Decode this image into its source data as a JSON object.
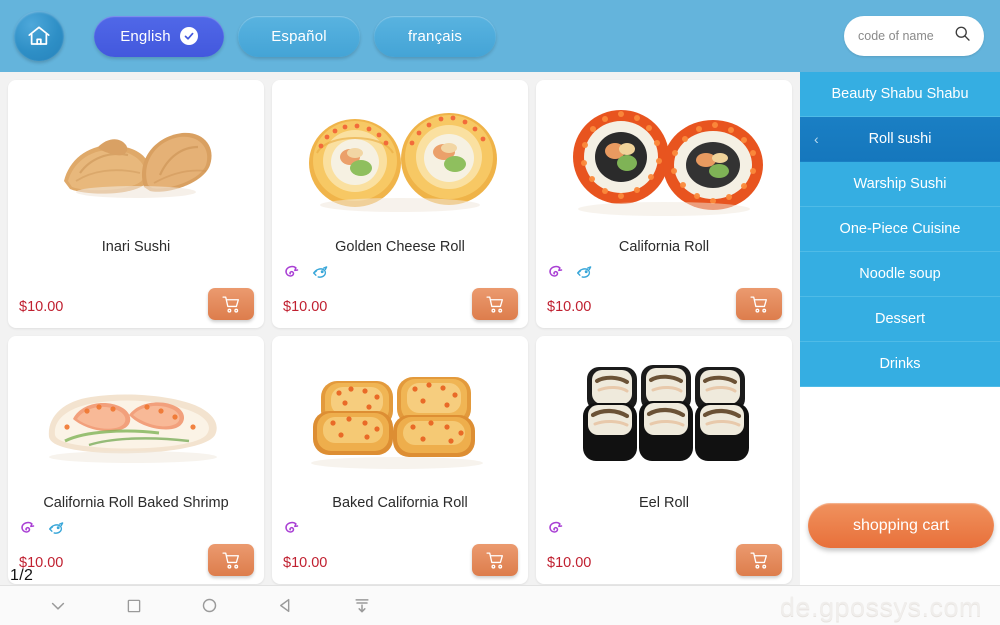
{
  "header": {
    "home_icon": "home-icon",
    "search": {
      "placeholder": "code of name",
      "value": "",
      "icon": "search-icon"
    },
    "languages": [
      {
        "label": "English",
        "active": true,
        "check_icon": "check-circle-icon"
      },
      {
        "label": "Español",
        "active": false
      },
      {
        "label": "français",
        "active": false
      }
    ]
  },
  "products": [
    {
      "name": "Inari Sushi",
      "price": "$10.00",
      "image": "inari-sushi-photo",
      "badges": [],
      "cart_icon": "shopping-cart-icon"
    },
    {
      "name": "Golden Cheese Roll",
      "price": "$10.00",
      "image": "golden-cheese-roll-photo",
      "badges": [
        "spicy-swirl-icon",
        "fish-icon"
      ],
      "cart_icon": "shopping-cart-icon"
    },
    {
      "name": "California Roll",
      "price": "$10.00",
      "image": "california-roll-photo",
      "badges": [
        "spicy-swirl-icon",
        "fish-icon"
      ],
      "cart_icon": "shopping-cart-icon"
    },
    {
      "name": "California Roll Baked Shrimp",
      "price": "$10.00",
      "image": "california-roll-baked-shrimp-photo",
      "badges": [
        "spicy-swirl-icon",
        "fish-icon"
      ],
      "cart_icon": "shopping-cart-icon"
    },
    {
      "name": "Baked California Roll",
      "price": "$10.00",
      "image": "baked-california-roll-photo",
      "badges": [
        "spicy-swirl-icon"
      ],
      "cart_icon": "shopping-cart-icon"
    },
    {
      "name": "Eel Roll",
      "price": "$10.00",
      "image": "eel-roll-photo",
      "badges": [
        "spicy-swirl-icon"
      ],
      "cart_icon": "shopping-cart-icon"
    }
  ],
  "pagination": {
    "label": "1/2"
  },
  "sidebar": {
    "categories": [
      {
        "label": "Beauty Shabu Shabu",
        "active": false
      },
      {
        "label": "Roll sushi",
        "active": true,
        "chevron": "‹"
      },
      {
        "label": "Warship Sushi",
        "active": false
      },
      {
        "label": "One-Piece Cuisine",
        "active": false
      },
      {
        "label": "Noodle soup",
        "active": false
      },
      {
        "label": "Dessert",
        "active": false
      },
      {
        "label": "Drinks",
        "active": false
      }
    ],
    "shopping_cart_label": "shopping cart"
  },
  "bottom_nav": {
    "items": [
      {
        "icon": "chevron-down-icon"
      },
      {
        "icon": "square-icon"
      },
      {
        "icon": "circle-icon"
      },
      {
        "icon": "back-triangle-icon"
      },
      {
        "icon": "collapse-down-icon"
      }
    ]
  },
  "watermark": "de.gpossys.com",
  "colors": {
    "header_bg": "#64b4dc",
    "sidebar_item": "#35aee2",
    "sidebar_active": "#1577bd",
    "price": "#c02030",
    "cart_button": "#dd7d4c",
    "shopping_cart_button": "#e8703a",
    "active_language": "#4358dd",
    "badge_spicy": "#a93fd4",
    "badge_fish": "#3aa7d9"
  }
}
